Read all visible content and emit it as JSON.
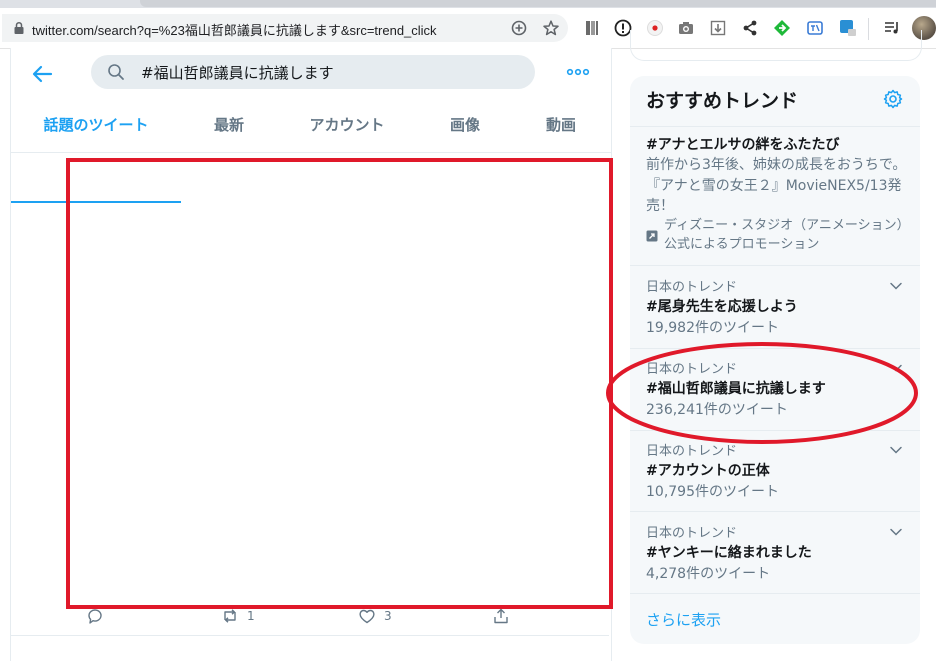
{
  "browser": {
    "url": "twitter.com/search?q=%23福山哲郎議員に抗議します&src=trend_click",
    "icons": [
      "lock-icon",
      "search-engine-icon",
      "bookmark-star-icon",
      "extension-icons",
      "profile-avatar"
    ]
  },
  "header": {
    "search_query": "#福山哲郎議員に抗議します",
    "back_icon": "arrow-left-icon",
    "more_icon": "more-dots-icon"
  },
  "tabs": [
    {
      "label": "話題のツイート",
      "active": true
    },
    {
      "label": "最新",
      "active": false
    },
    {
      "label": "アカウント",
      "active": false
    },
    {
      "label": "画像",
      "active": false
    },
    {
      "label": "動画",
      "active": false
    }
  ],
  "tweet": {
    "actions": {
      "reply_count": "",
      "retweet_count": "1",
      "like_count": "3"
    }
  },
  "sidebar": {
    "title": "おすすめトレンド",
    "promo": {
      "title": "#アナとエルサの絆をふたたび",
      "description": "前作から3年後、姉妹の成長をおうちで。『アナと雪の女王２』MovieNEX5/13発売！",
      "promoted_by": "ディズニー・スタジオ（アニメーション）公式によるプロモーション"
    },
    "trends": [
      {
        "category": "日本のトレンド",
        "name": "#尾身先生を応援しよう",
        "count": "19,982件のツイート"
      },
      {
        "category": "日本のトレンド",
        "name": "#福山哲郎議員に抗議します",
        "count": "236,241件のツイート"
      },
      {
        "category": "日本のトレンド",
        "name": "#アカウントの正体",
        "count": "10,795件のツイート"
      },
      {
        "category": "日本のトレンド",
        "name": "#ヤンキーに絡まれました",
        "count": "4,278件のツイート"
      }
    ],
    "show_more": "さらに表示"
  },
  "colors": {
    "accent": "#1da1f2",
    "annotation_red": "#e0192a",
    "muted_text": "#657786",
    "sidebar_bg": "#f5f8fa"
  }
}
